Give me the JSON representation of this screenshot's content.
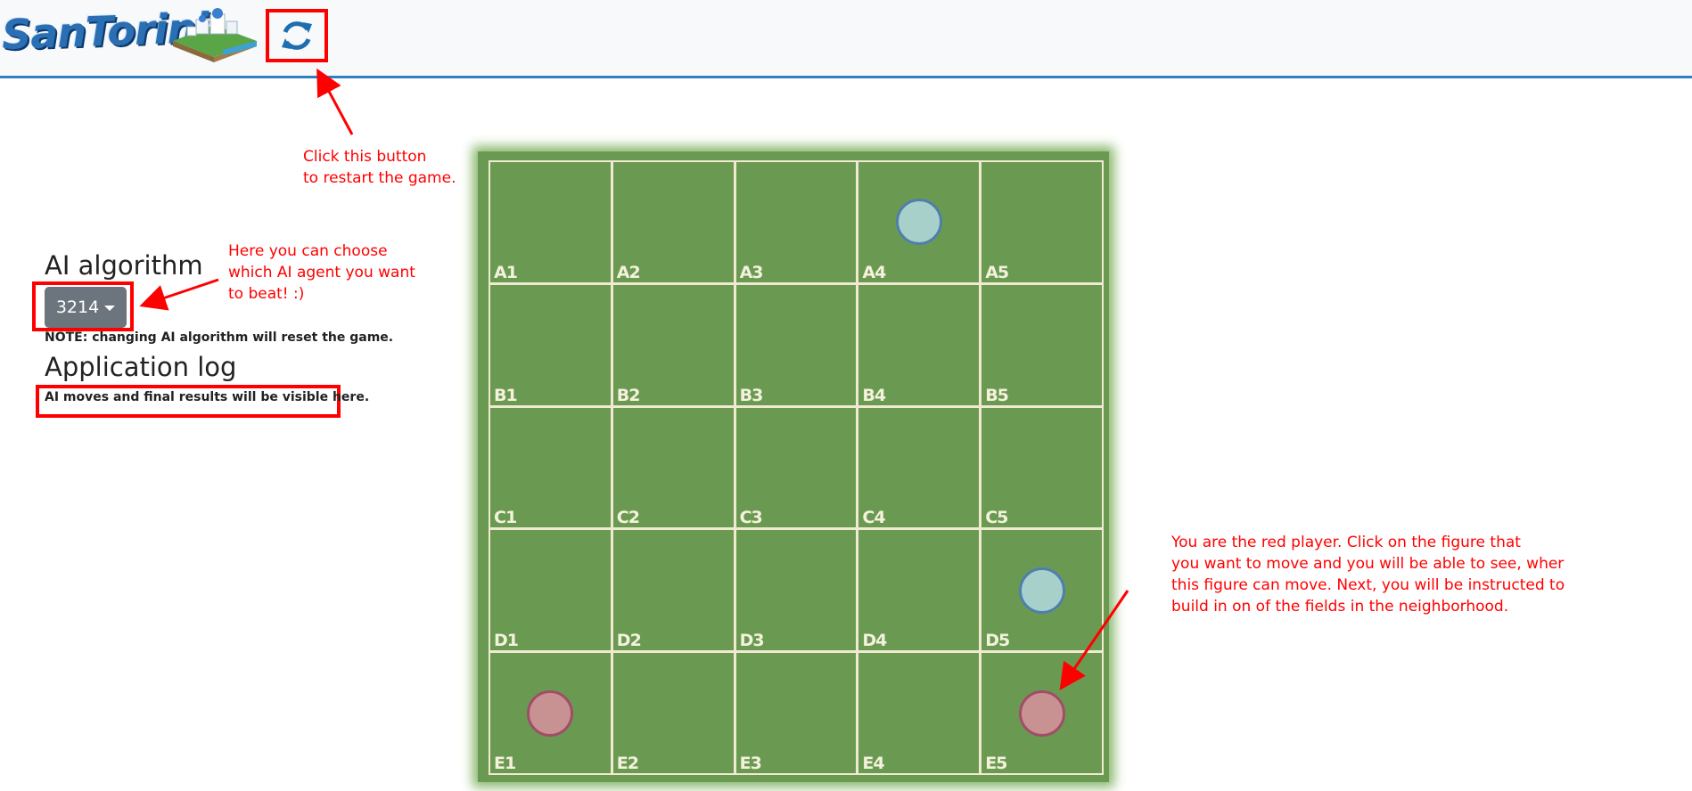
{
  "header": {
    "logo_text": "SanTorini",
    "refresh_icon": "refresh-icon"
  },
  "annotations": {
    "restart": "Click this button\nto restart the game.",
    "ai_choose": "Here you can choose\nwhich AI agent you want\nto beat! :)",
    "red_player": "You are the red player. Click on the figure that\nyou want to move and you will be able to see, wher\nthis figure can move. Next, you will be instructed to\nbuild in on of the fields in the neighborhood."
  },
  "sidebar": {
    "algorithm_heading": "AI algorithm",
    "algorithm_selected": "3214",
    "note": "NOTE: changing AI algorithm will reset the game.",
    "log_heading": "Application log",
    "log_text": "AI moves and final results will be visible here."
  },
  "board": {
    "rows": [
      "A",
      "B",
      "C",
      "D",
      "E"
    ],
    "cols": [
      1,
      2,
      3,
      4,
      5
    ],
    "pieces": {
      "A4": "blue",
      "D5": "blue",
      "E1": "red",
      "E5": "red"
    }
  },
  "colors": {
    "board_green": "#6a9a52",
    "annotation_red": "#ff0000",
    "blue_piece": "#a8d0cb",
    "red_piece": "#c99292"
  }
}
